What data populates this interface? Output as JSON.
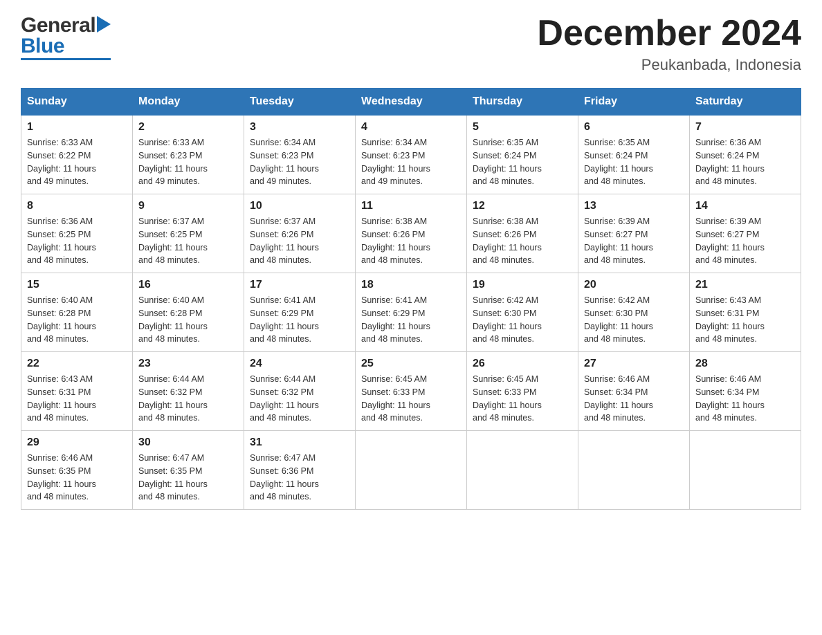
{
  "header": {
    "logo_general": "General",
    "logo_blue": "Blue",
    "month_title": "December 2024",
    "location": "Peukanbada, Indonesia"
  },
  "days_of_week": [
    "Sunday",
    "Monday",
    "Tuesday",
    "Wednesday",
    "Thursday",
    "Friday",
    "Saturday"
  ],
  "weeks": [
    [
      {
        "day": "1",
        "sunrise": "6:33 AM",
        "sunset": "6:22 PM",
        "daylight": "11 hours and 49 minutes."
      },
      {
        "day": "2",
        "sunrise": "6:33 AM",
        "sunset": "6:23 PM",
        "daylight": "11 hours and 49 minutes."
      },
      {
        "day": "3",
        "sunrise": "6:34 AM",
        "sunset": "6:23 PM",
        "daylight": "11 hours and 49 minutes."
      },
      {
        "day": "4",
        "sunrise": "6:34 AM",
        "sunset": "6:23 PM",
        "daylight": "11 hours and 49 minutes."
      },
      {
        "day": "5",
        "sunrise": "6:35 AM",
        "sunset": "6:24 PM",
        "daylight": "11 hours and 48 minutes."
      },
      {
        "day": "6",
        "sunrise": "6:35 AM",
        "sunset": "6:24 PM",
        "daylight": "11 hours and 48 minutes."
      },
      {
        "day": "7",
        "sunrise": "6:36 AM",
        "sunset": "6:24 PM",
        "daylight": "11 hours and 48 minutes."
      }
    ],
    [
      {
        "day": "8",
        "sunrise": "6:36 AM",
        "sunset": "6:25 PM",
        "daylight": "11 hours and 48 minutes."
      },
      {
        "day": "9",
        "sunrise": "6:37 AM",
        "sunset": "6:25 PM",
        "daylight": "11 hours and 48 minutes."
      },
      {
        "day": "10",
        "sunrise": "6:37 AM",
        "sunset": "6:26 PM",
        "daylight": "11 hours and 48 minutes."
      },
      {
        "day": "11",
        "sunrise": "6:38 AM",
        "sunset": "6:26 PM",
        "daylight": "11 hours and 48 minutes."
      },
      {
        "day": "12",
        "sunrise": "6:38 AM",
        "sunset": "6:26 PM",
        "daylight": "11 hours and 48 minutes."
      },
      {
        "day": "13",
        "sunrise": "6:39 AM",
        "sunset": "6:27 PM",
        "daylight": "11 hours and 48 minutes."
      },
      {
        "day": "14",
        "sunrise": "6:39 AM",
        "sunset": "6:27 PM",
        "daylight": "11 hours and 48 minutes."
      }
    ],
    [
      {
        "day": "15",
        "sunrise": "6:40 AM",
        "sunset": "6:28 PM",
        "daylight": "11 hours and 48 minutes."
      },
      {
        "day": "16",
        "sunrise": "6:40 AM",
        "sunset": "6:28 PM",
        "daylight": "11 hours and 48 minutes."
      },
      {
        "day": "17",
        "sunrise": "6:41 AM",
        "sunset": "6:29 PM",
        "daylight": "11 hours and 48 minutes."
      },
      {
        "day": "18",
        "sunrise": "6:41 AM",
        "sunset": "6:29 PM",
        "daylight": "11 hours and 48 minutes."
      },
      {
        "day": "19",
        "sunrise": "6:42 AM",
        "sunset": "6:30 PM",
        "daylight": "11 hours and 48 minutes."
      },
      {
        "day": "20",
        "sunrise": "6:42 AM",
        "sunset": "6:30 PM",
        "daylight": "11 hours and 48 minutes."
      },
      {
        "day": "21",
        "sunrise": "6:43 AM",
        "sunset": "6:31 PM",
        "daylight": "11 hours and 48 minutes."
      }
    ],
    [
      {
        "day": "22",
        "sunrise": "6:43 AM",
        "sunset": "6:31 PM",
        "daylight": "11 hours and 48 minutes."
      },
      {
        "day": "23",
        "sunrise": "6:44 AM",
        "sunset": "6:32 PM",
        "daylight": "11 hours and 48 minutes."
      },
      {
        "day": "24",
        "sunrise": "6:44 AM",
        "sunset": "6:32 PM",
        "daylight": "11 hours and 48 minutes."
      },
      {
        "day": "25",
        "sunrise": "6:45 AM",
        "sunset": "6:33 PM",
        "daylight": "11 hours and 48 minutes."
      },
      {
        "day": "26",
        "sunrise": "6:45 AM",
        "sunset": "6:33 PM",
        "daylight": "11 hours and 48 minutes."
      },
      {
        "day": "27",
        "sunrise": "6:46 AM",
        "sunset": "6:34 PM",
        "daylight": "11 hours and 48 minutes."
      },
      {
        "day": "28",
        "sunrise": "6:46 AM",
        "sunset": "6:34 PM",
        "daylight": "11 hours and 48 minutes."
      }
    ],
    [
      {
        "day": "29",
        "sunrise": "6:46 AM",
        "sunset": "6:35 PM",
        "daylight": "11 hours and 48 minutes."
      },
      {
        "day": "30",
        "sunrise": "6:47 AM",
        "sunset": "6:35 PM",
        "daylight": "11 hours and 48 minutes."
      },
      {
        "day": "31",
        "sunrise": "6:47 AM",
        "sunset": "6:36 PM",
        "daylight": "11 hours and 48 minutes."
      },
      null,
      null,
      null,
      null
    ]
  ],
  "labels": {
    "sunrise": "Sunrise:",
    "sunset": "Sunset:",
    "daylight": "Daylight:"
  }
}
